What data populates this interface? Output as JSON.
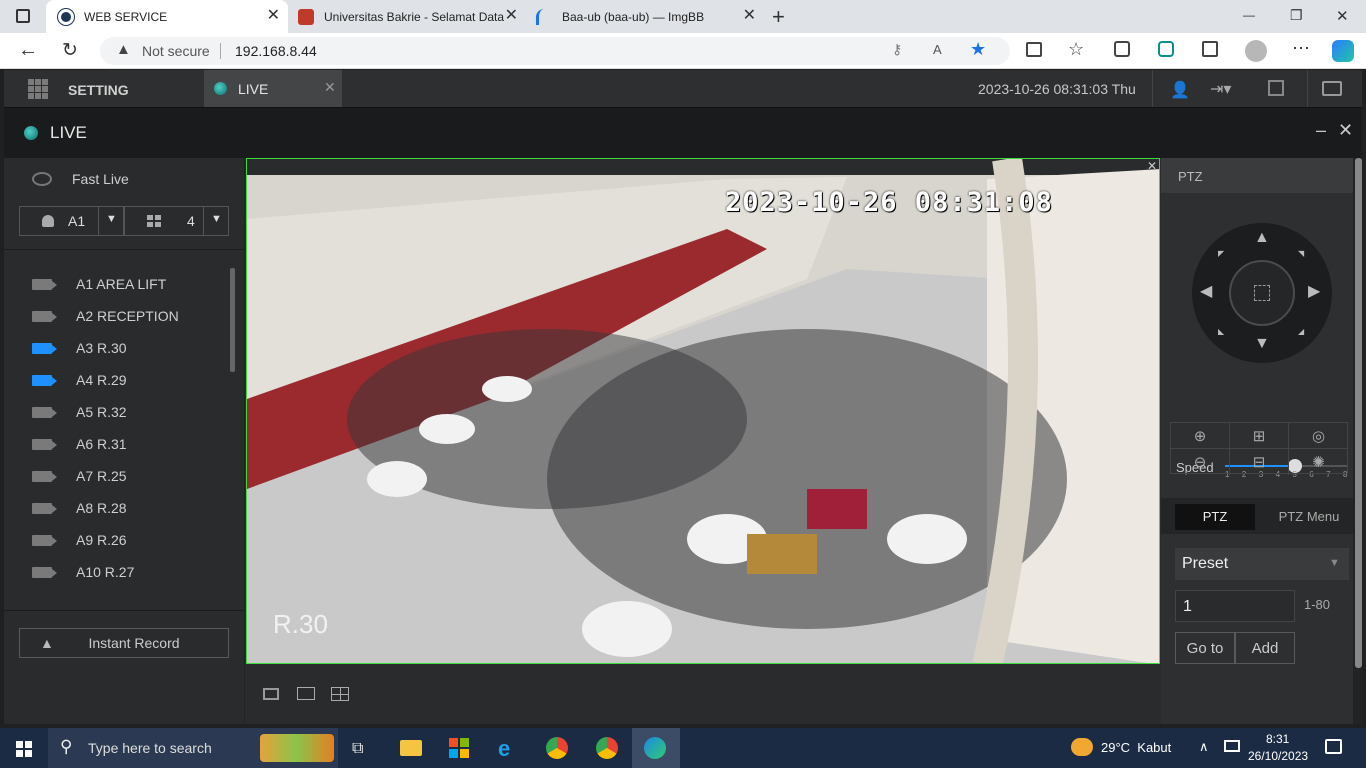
{
  "browser": {
    "tabs": [
      {
        "title": "WEB SERVICE",
        "active": true
      },
      {
        "title": "Universitas Bakrie - Selamat Data",
        "active": false
      },
      {
        "title": "Baa-ub (baa-ub) — ImgBB",
        "active": false
      }
    ],
    "security_label": "Not secure",
    "url": "192.168.8.44",
    "controls": {
      "minimize": "—",
      "restore": "❐",
      "close": "✕",
      "new_tab": "+"
    }
  },
  "topnav": {
    "setting_label": "SETTING",
    "live_tab_label": "LIVE",
    "datetime": "2023-10-26 08:31:03 Thu"
  },
  "live_header": {
    "title": "LIVE"
  },
  "left_panel": {
    "fast_live_label": "Fast Live",
    "area_select": "A1",
    "layout_select": "4",
    "cameras": [
      {
        "label": "A1 AREA LIFT",
        "active": false
      },
      {
        "label": "A2 RECEPTION",
        "active": false
      },
      {
        "label": "A3 R.30",
        "active": true
      },
      {
        "label": "A4 R.29",
        "active": true
      },
      {
        "label": "A5 R.32",
        "active": false
      },
      {
        "label": "A6 R.31",
        "active": false
      },
      {
        "label": "A7 R.25",
        "active": false
      },
      {
        "label": "A8 R.28",
        "active": false
      },
      {
        "label": "A9 R.26",
        "active": false
      },
      {
        "label": "A10 R.27",
        "active": false
      }
    ],
    "instant_record_label": "Instant Record"
  },
  "video": {
    "overlay_timestamp": "2023-10-26 08:31:08",
    "channel_overlay": "R.30"
  },
  "ptz": {
    "panel_title": "PTZ",
    "speed_label": "Speed",
    "speed_ticks": [
      "1",
      "2",
      "3",
      "4",
      "5",
      "6",
      "7",
      "8"
    ],
    "speed_value": 5,
    "tab_ptz": "PTZ",
    "tab_ptz_menu": "PTZ Menu",
    "preset_select": "Preset",
    "preset_value": "1",
    "preset_range": "1-80",
    "goto_label": "Go to",
    "add_label": "Add"
  },
  "taskbar": {
    "search_placeholder": "Type here to search",
    "weather": "29°C  Kabut",
    "time": "8:31",
    "date": "26/10/2023"
  }
}
